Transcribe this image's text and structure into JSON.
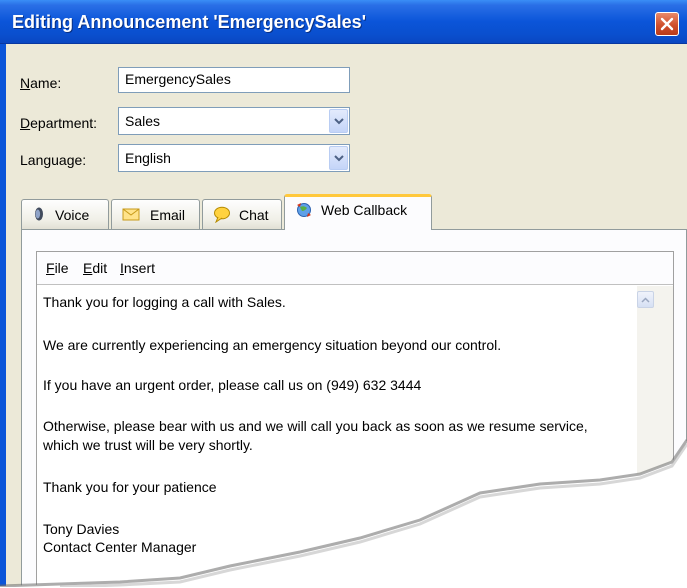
{
  "window": {
    "title": "Editing Announcement 'EmergencySales'"
  },
  "form": {
    "name": {
      "label_underline": "N",
      "label_rest": "ame:",
      "value": "EmergencySales"
    },
    "department": {
      "label_underline": "D",
      "label_rest": "epartment:",
      "value": "Sales"
    },
    "language": {
      "label_underline": "",
      "label_rest": "Language:",
      "value": "English"
    }
  },
  "tabs": [
    {
      "label": "Voice",
      "icon": "speaker-icon"
    },
    {
      "label": "Email",
      "icon": "envelope-icon"
    },
    {
      "label": "Chat",
      "icon": "chat-bubble-icon"
    },
    {
      "label": "Web Callback",
      "icon": "web-callback-icon",
      "active": true
    }
  ],
  "editor": {
    "menu": [
      {
        "underline": "F",
        "rest": "ile"
      },
      {
        "underline": "E",
        "rest": "dit"
      },
      {
        "underline": "I",
        "rest": "nsert"
      }
    ],
    "lines": [
      "Thank you for logging a call with Sales.",
      "We are currently experiencing an emergency situation beyond our control.",
      "If you have an urgent order, please call us on (949) 632 3444",
      "Otherwise, please bear with us and we will call you back as soon as we resume service,",
      "which we trust will be very shortly.",
      "Thank you for your patience",
      "Tony Davies",
      "Contact Center Manager"
    ]
  },
  "colors": {
    "titlebar": "#0b55d9",
    "active_tab_accent": "#ffc83c",
    "close_button": "#d0502e"
  }
}
